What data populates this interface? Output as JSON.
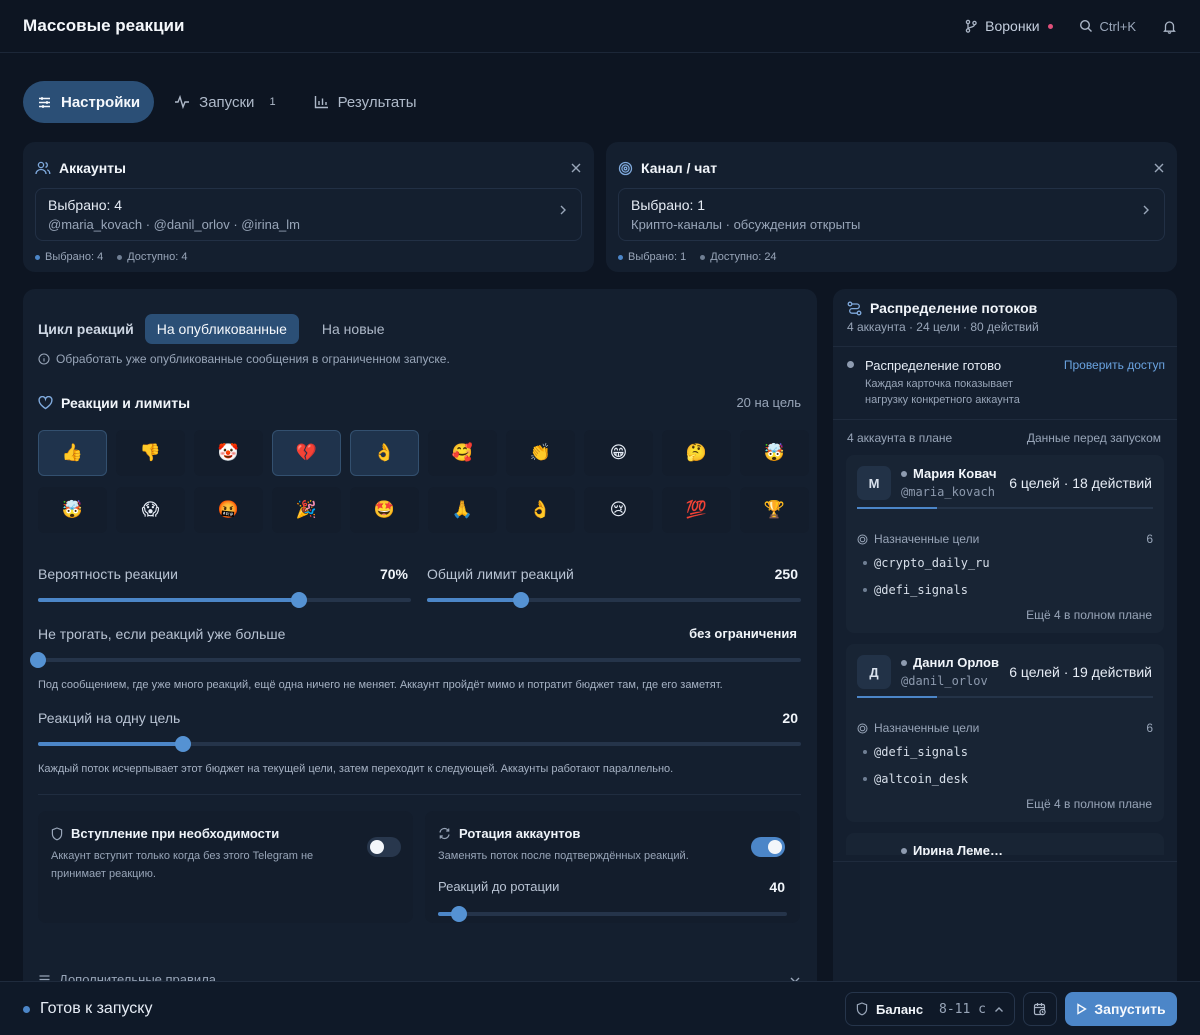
{
  "header": {
    "title": "Массовые реакции",
    "funnels_label": "Воронки",
    "search_shortcut": "Ctrl+K"
  },
  "tabs": [
    {
      "label": "Настройки",
      "active": true
    },
    {
      "label": "Запуски",
      "count": "1"
    },
    {
      "label": "Результаты"
    }
  ],
  "accounts_card": {
    "title": "Аккаунты",
    "selected_label": "Выбрано: 4",
    "selected_list": "@maria_kovach · @danil_orlov · @irina_lm",
    "stat_selected": "Выбрано: 4",
    "stat_available": "Доступно: 4"
  },
  "channel_card": {
    "title": "Канал / чат",
    "selected_label": "Выбрано: 1",
    "selected_list": "Крипто-каналы · обсуждения открыты",
    "stat_selected": "Выбрано: 1",
    "stat_available": "Доступно: 24"
  },
  "settings": {
    "cycle_label": "Цикл реакций",
    "cycle_options": [
      "На опубликованные",
      "На новые"
    ],
    "cycle_hint": "Обработать уже опубликованные сообщения в ограниченном запуске.",
    "reactions_title": "Реакции и лимиты",
    "reactions_meta": "20 на цель",
    "emojis": [
      "👍",
      "👎",
      "🤡",
      "💔",
      "👌",
      "🥰",
      "👏",
      "😁",
      "🤔",
      "🤯",
      "🤯",
      "😱",
      "🤬",
      "🎉",
      "🤩",
      "🙏",
      "👌",
      "😢",
      "💯",
      "🏆"
    ],
    "emoji_selected": [
      true,
      false,
      false,
      true,
      true,
      false,
      false,
      false,
      false,
      false,
      false,
      false,
      false,
      false,
      false,
      false,
      false,
      false,
      false,
      false
    ],
    "probability": {
      "label": "Вероятность реакции",
      "value_text": "70%",
      "value": 0.7
    },
    "total_limit": {
      "label": "Общий лимит реакций",
      "value_text": "250",
      "value": 0.25
    },
    "skip_if_more": {
      "label": "Не трогать, если реакций уже больше",
      "value_text": "без ограничения",
      "value": 0.0,
      "note": "Под сообщением, где уже много реакций, ещё одна ничего не меняет. Аккаунт пройдёт мимо и потратит бюджет там, где его заметят."
    },
    "per_target": {
      "label": "Реакций на одну цель",
      "value_text": "20",
      "value": 0.19,
      "note": "Каждый поток исчерпывает этот бюджет на текущей цели, затем переходит к следующей. Аккаунты работают параллельно."
    },
    "join_option": {
      "title": "Вступление при необходимости",
      "desc": "Аккаунт вступит только когда без этого Telegram не принимает реакцию.",
      "enabled": false
    },
    "rotation_option": {
      "title": "Ротация аккаунтов",
      "desc": "Заменять поток после подтверждённых реакций.",
      "enabled": true,
      "rotation_label": "Реакций до ротации",
      "rotation_value_text": "40",
      "rotation_value": 0.06
    },
    "extra_rules": "Дополнительные правила"
  },
  "distribution": {
    "title": "Распределение потоков",
    "subtitle": "4 аккаунта · 24 цели · 80 действий",
    "status_title": "Распределение готово",
    "status_desc": "Каждая карточка показывает нагрузку конкретного аккаунта",
    "check_access": "Проверить доступ",
    "plan_label": "4 аккаунта в плане",
    "plan_note": "Данные перед запуском",
    "targets_label": "Назначенные цели",
    "accounts": [
      {
        "initial": "М",
        "name": "Мария Ковач",
        "handle": "@maria_kovach",
        "stats": "6 целей · 18 действий",
        "targets_count": "6",
        "targets": [
          "@crypto_daily_ru",
          "@defi_signals"
        ],
        "more": "Ещё 4 в полном плане"
      },
      {
        "initial": "Д",
        "name": "Данил Орлов",
        "handle": "@danil_orlov",
        "stats": "6 целей · 19 действий",
        "targets_count": "6",
        "targets": [
          "@defi_signals",
          "@altcoin_desk"
        ],
        "more": "Ещё 4 в полном плане"
      },
      {
        "initial": "И",
        "name": "Ирина Леме…",
        "handle": "",
        "stats": ""
      }
    ]
  },
  "footer": {
    "status": "Готов к запуску",
    "balance_label": "Баланс",
    "balance_range": "8-11 с",
    "run_label": "Запустить"
  },
  "colors": {
    "accent": "#4c86c8",
    "active_tab": "#2b4f76",
    "ready_dot": "#4c86c8"
  }
}
